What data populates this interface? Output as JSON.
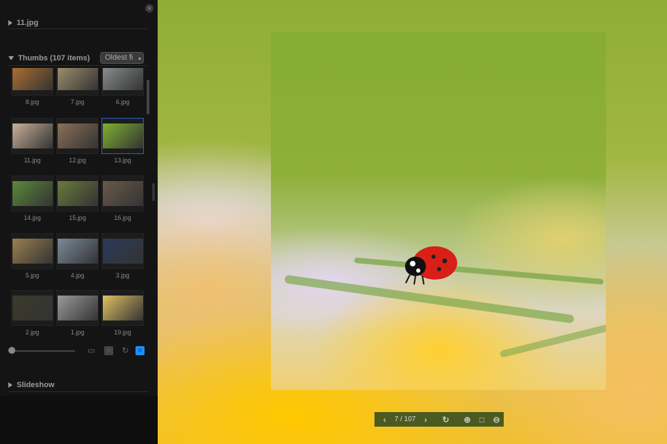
{
  "sidebar": {
    "current_file": "11.jpg",
    "thumbs_title": "Thumbs (107 items)",
    "sort_select": "Oldest fi",
    "slideshow_title": "Slideshow",
    "thumbs": [
      {
        "label": "8.jpg",
        "color": "#b07030"
      },
      {
        "label": "7.jpg",
        "color": "#a09070"
      },
      {
        "label": "6.jpg",
        "color": "#8a9090"
      },
      {
        "label": "11.jpg",
        "color": "#c8b098"
      },
      {
        "label": "12.jpg",
        "color": "#8a7058"
      },
      {
        "label": "13.jpg",
        "color": "#80b030",
        "selected": true
      },
      {
        "label": "14.jpg",
        "color": "#5a8a3a"
      },
      {
        "label": "15.jpg",
        "color": "#6a7a3a"
      },
      {
        "label": "16.jpg",
        "color": "#6a5a4a"
      },
      {
        "label": "5.jpg",
        "color": "#9a8050"
      },
      {
        "label": "4.jpg",
        "color": "#7a8a9a"
      },
      {
        "label": "3.jpg",
        "color": "#2a3a5a"
      },
      {
        "label": "2.jpg",
        "color": "#3a3a2a"
      },
      {
        "label": "1.jpg",
        "color": "#9a9a9a"
      },
      {
        "label": "19.jpg",
        "color": "#e0c060"
      }
    ],
    "toolbar": [
      "folder-icon",
      "clear-icon",
      "refresh-icon",
      "list-icon"
    ],
    "active_color": "#1e90ff"
  },
  "viewer": {
    "counter": "7 / 107"
  }
}
